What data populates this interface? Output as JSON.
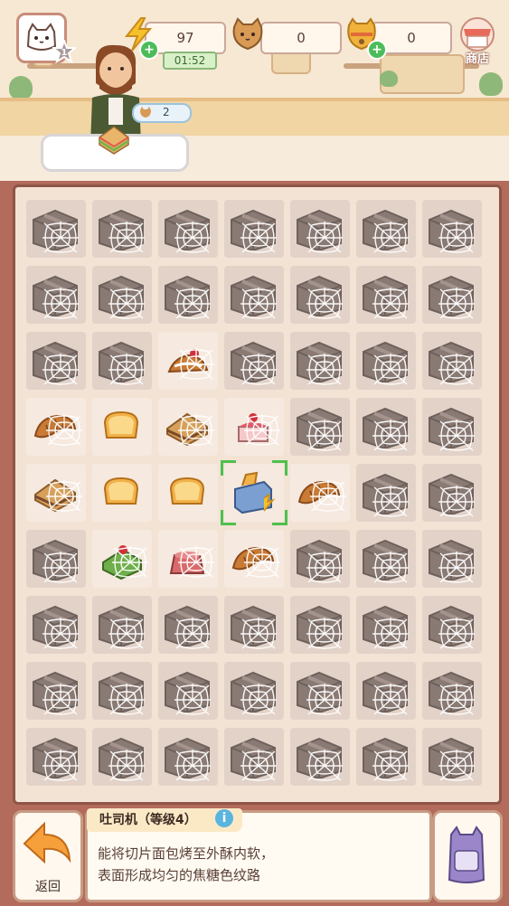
{
  "hud": {
    "energy_value": "97",
    "energy_timer": "01:52",
    "coins_value": "0",
    "bells_value": "0",
    "level_value": "1",
    "shop_label": "商店"
  },
  "customer": {
    "order_count": "2"
  },
  "board": {
    "rows": [
      [
        "box",
        "box",
        "box",
        "box",
        "box",
        "box",
        "box"
      ],
      [
        "box",
        "box",
        "box",
        "box",
        "box",
        "box",
        "box"
      ],
      [
        "box",
        "box",
        "cupcake-web",
        "box",
        "box",
        "box",
        "box"
      ],
      [
        "croissant-web",
        "toast",
        "sandwich-web",
        "cake-web",
        "box",
        "box",
        "box"
      ],
      [
        "sandwich-web",
        "toast",
        "toast",
        "toaster-selected",
        "croissant-web",
        "box",
        "box"
      ],
      [
        "box",
        "cake-slice-web",
        "pudding-web",
        "croissant-web",
        "box",
        "box",
        "box"
      ],
      [
        "box",
        "box",
        "box",
        "box",
        "box",
        "box",
        "box"
      ],
      [
        "box",
        "box",
        "box",
        "box",
        "box",
        "box",
        "box"
      ],
      [
        "box",
        "box",
        "box",
        "box",
        "box",
        "box",
        "box"
      ]
    ]
  },
  "info": {
    "title": "吐司机（等级4）",
    "line1": "能将切片面包烤至外酥内软，",
    "line2": "表面形成均匀的焦糖色纹路"
  },
  "bottom": {
    "back_label": "返回"
  },
  "colors": {
    "accent_green": "#4ec04e",
    "board_border": "#8e5548",
    "frame_bg": "#b36b5c"
  }
}
